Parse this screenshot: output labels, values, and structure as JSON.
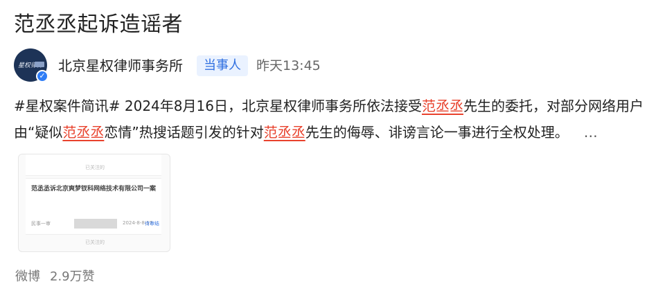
{
  "post": {
    "title": "范丞丞起诉造谣者",
    "author": "北京星权律师事务所",
    "role_tag": "当事人",
    "time": "昨天13:45",
    "body_segments": [
      "#星权案件简讯# 2024年8月16日，北京星权律师事务所依法接受",
      "范丞丞",
      "先生的委托，对部分网络用户由“疑似",
      "范丞丞",
      "恋情”热搜话题引发的针对",
      "范丞丞",
      "先生的侮辱、诽谤言论一事进行全权处理。"
    ],
    "more": "…",
    "source": "微博",
    "likes": "2.9万赞"
  },
  "thumbnail": {
    "top_label": "已关注的",
    "card_title": "范丞丞诉北京爽梦钗科网络技术有限公司一案",
    "row_left": "民事一审",
    "row_date": "2024-8-8-17",
    "row_link": "待审结",
    "bottom_label": "已关注的"
  },
  "avatar": {
    "text": "星权律师"
  },
  "colors": {
    "highlight": "#e8412c",
    "tag_bg": "#eaf2ff",
    "tag_fg": "#2f6fe0",
    "verify": "#2f7df6"
  }
}
